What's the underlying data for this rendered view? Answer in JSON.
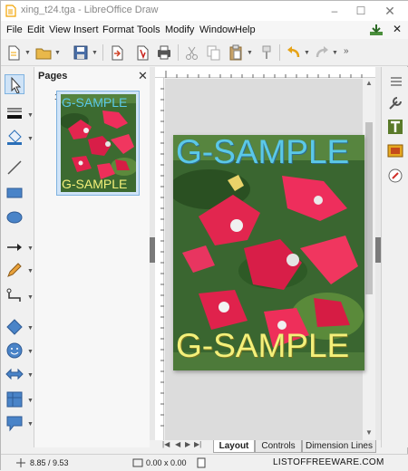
{
  "window": {
    "title": "xing_t24.tga - LibreOffice Draw"
  },
  "menu": [
    "File",
    "Edit",
    "View",
    "Insert",
    "Format",
    "Tools",
    "Modify",
    "Window",
    "Help"
  ],
  "pages_panel": {
    "title": "Pages",
    "page_number": "1"
  },
  "image": {
    "watermark_top": "G-SAMPLE",
    "watermark_bottom": "G-SAMPLE",
    "top_color": "#5bc8e8",
    "bottom_color": "#f4f07a"
  },
  "tabs": [
    "Layout",
    "Controls",
    "Dimension Lines"
  ],
  "status": {
    "coordinates": "8.85 / 9.53",
    "size": "0.00 x 0.00"
  },
  "brand": "LISTOFFREEWARE.COM",
  "colors": {
    "accent": "#2a7ab8",
    "page_bg": "#dcdcdc"
  }
}
